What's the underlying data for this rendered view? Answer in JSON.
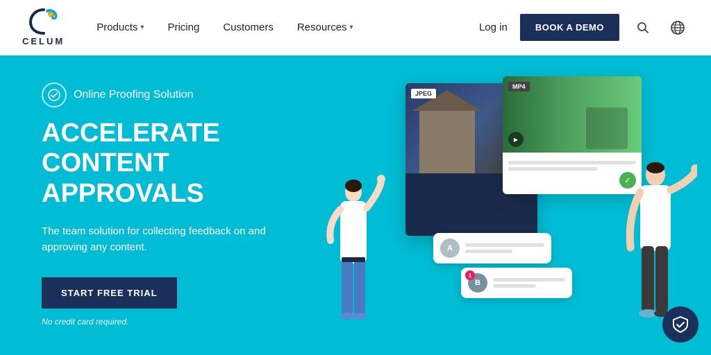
{
  "navbar": {
    "logo_text": "CELUM",
    "nav_items": [
      {
        "label": "Products",
        "has_dropdown": true
      },
      {
        "label": "Pricing",
        "has_dropdown": false
      },
      {
        "label": "Customers",
        "has_dropdown": false
      },
      {
        "label": "Resources",
        "has_dropdown": true
      }
    ],
    "login_label": "Log in",
    "book_demo_label": "BOOK A DEMO"
  },
  "hero": {
    "badge_text": "Online Proofing Solution",
    "title_line1": "ACCELERATE CONTENT",
    "title_line2": "APPROVALS",
    "description": "The team solution for collecting feedback on and approving any content.",
    "cta_button": "START FREE TRIAL",
    "no_cc_text": "No credit card required.",
    "card1_label": "JPEG",
    "card2_label": "MP4"
  }
}
